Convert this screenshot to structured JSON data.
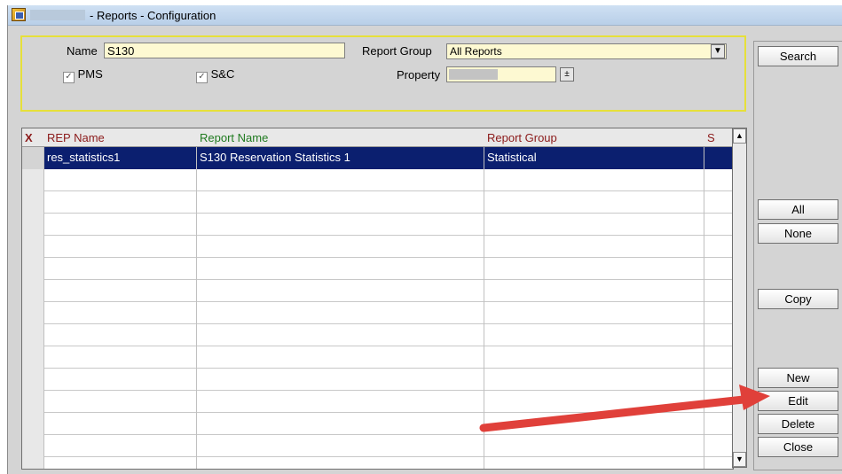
{
  "window": {
    "title": "- Reports - Configuration"
  },
  "filters": {
    "name_label": "Name",
    "name_value": "S130",
    "report_group_label": "Report Group",
    "report_group_value": "All Reports",
    "property_label": "Property",
    "pms_label": "PMS",
    "pms_checked": true,
    "sc_label": "S&C",
    "sc_checked": true
  },
  "grid": {
    "headers": {
      "x": "X",
      "rep_name": "REP Name",
      "report_name": "Report Name",
      "report_group": "Report Group",
      "s": "S"
    },
    "header_colors": {
      "rep_name": "#8b1a1a",
      "report_name": "#1f7a1f",
      "report_group": "#8b1a1a",
      "s": "#8b1a1a"
    },
    "rows": [
      {
        "rep_name": "res_statistics1",
        "report_name": "S130 Reservation Statistics 1",
        "report_group": "Statistical",
        "selected": true
      }
    ]
  },
  "buttons": {
    "search": "Search",
    "all": "All",
    "none": "None",
    "copy": "Copy",
    "new": "New",
    "edit": "Edit",
    "delete": "Delete",
    "close": "Close"
  },
  "annotation": {
    "arrow_color": "#e0403a"
  }
}
